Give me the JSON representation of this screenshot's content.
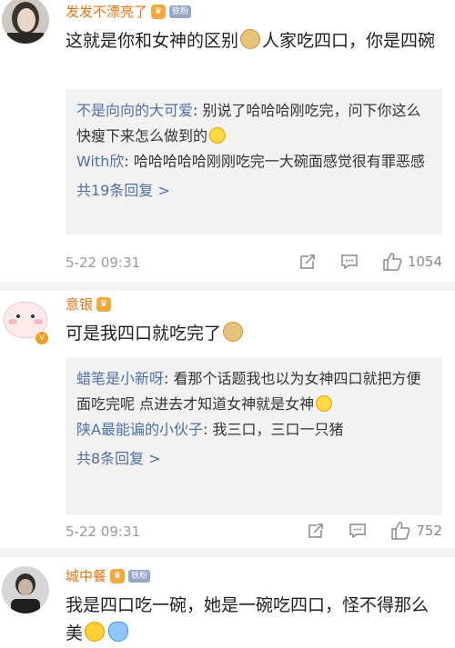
{
  "comments": [
    {
      "username": "发发不漂亮了",
      "fan_badge": "铁粉",
      "text_before": "这就是你和女神的区别",
      "text_after": "人家吃四口，你是四碗",
      "replies": [
        {
          "name": "不是向向的大可爱",
          "text": "别说了哈哈哈刚吃完，问下你这么快瘦下来怎么做到的"
        },
        {
          "name": "With欣",
          "text": "哈哈哈哈哈刚刚吃完一大碗面感觉很有罪恶感"
        }
      ],
      "more_replies": "共19条回复 >",
      "time": "5-22 09:31",
      "like_count": "1054"
    },
    {
      "username": "意银",
      "text_before": "可是我四口就吃完了",
      "text_after": "",
      "replies": [
        {
          "name": "蜡笔是小新呀",
          "text": "看那个话题我也以为女神四口就把方便面吃完呢 点进去才知道女神就是女神"
        },
        {
          "name": "陕A最能谝的小伙子",
          "text": "我三口，三口一只猪"
        }
      ],
      "more_replies": "共8条回复 >",
      "time": "5-22 09:31",
      "like_count": "752"
    },
    {
      "username": "城中餐",
      "fan_badge": "铁粉",
      "text_before": "我是四口吃一碗，她是一碗吃四口，怪不得那么美"
    }
  ],
  "colors": {
    "username": "#e8740f",
    "reply_name": "#4f6fa8",
    "reply_bg": "#f2f2f2",
    "meta": "#999999"
  },
  "icons": [
    "doge-emoji",
    "smile-emoji",
    "laugh-emoji",
    "kid-emoji",
    "share-icon",
    "comment-icon",
    "like-icon",
    "vip-badge-icon",
    "verified-icon"
  ]
}
